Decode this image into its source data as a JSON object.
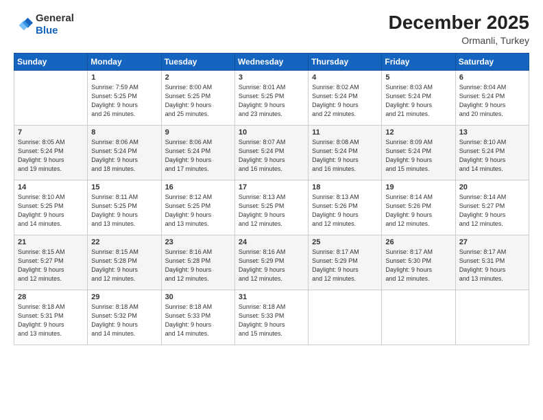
{
  "header": {
    "logo_line1": "General",
    "logo_line2": "Blue",
    "title": "December 2025",
    "subtitle": "Ormanli, Turkey"
  },
  "columns": [
    "Sunday",
    "Monday",
    "Tuesday",
    "Wednesday",
    "Thursday",
    "Friday",
    "Saturday"
  ],
  "weeks": [
    [
      {
        "day": "",
        "info": ""
      },
      {
        "day": "1",
        "info": "Sunrise: 7:59 AM\nSunset: 5:25 PM\nDaylight: 9 hours\nand 26 minutes."
      },
      {
        "day": "2",
        "info": "Sunrise: 8:00 AM\nSunset: 5:25 PM\nDaylight: 9 hours\nand 25 minutes."
      },
      {
        "day": "3",
        "info": "Sunrise: 8:01 AM\nSunset: 5:25 PM\nDaylight: 9 hours\nand 23 minutes."
      },
      {
        "day": "4",
        "info": "Sunrise: 8:02 AM\nSunset: 5:24 PM\nDaylight: 9 hours\nand 22 minutes."
      },
      {
        "day": "5",
        "info": "Sunrise: 8:03 AM\nSunset: 5:24 PM\nDaylight: 9 hours\nand 21 minutes."
      },
      {
        "day": "6",
        "info": "Sunrise: 8:04 AM\nSunset: 5:24 PM\nDaylight: 9 hours\nand 20 minutes."
      }
    ],
    [
      {
        "day": "7",
        "info": "Sunrise: 8:05 AM\nSunset: 5:24 PM\nDaylight: 9 hours\nand 19 minutes."
      },
      {
        "day": "8",
        "info": "Sunrise: 8:06 AM\nSunset: 5:24 PM\nDaylight: 9 hours\nand 18 minutes."
      },
      {
        "day": "9",
        "info": "Sunrise: 8:06 AM\nSunset: 5:24 PM\nDaylight: 9 hours\nand 17 minutes."
      },
      {
        "day": "10",
        "info": "Sunrise: 8:07 AM\nSunset: 5:24 PM\nDaylight: 9 hours\nand 16 minutes."
      },
      {
        "day": "11",
        "info": "Sunrise: 8:08 AM\nSunset: 5:24 PM\nDaylight: 9 hours\nand 16 minutes."
      },
      {
        "day": "12",
        "info": "Sunrise: 8:09 AM\nSunset: 5:24 PM\nDaylight: 9 hours\nand 15 minutes."
      },
      {
        "day": "13",
        "info": "Sunrise: 8:10 AM\nSunset: 5:24 PM\nDaylight: 9 hours\nand 14 minutes."
      }
    ],
    [
      {
        "day": "14",
        "info": "Sunrise: 8:10 AM\nSunset: 5:25 PM\nDaylight: 9 hours\nand 14 minutes."
      },
      {
        "day": "15",
        "info": "Sunrise: 8:11 AM\nSunset: 5:25 PM\nDaylight: 9 hours\nand 13 minutes."
      },
      {
        "day": "16",
        "info": "Sunrise: 8:12 AM\nSunset: 5:25 PM\nDaylight: 9 hours\nand 13 minutes."
      },
      {
        "day": "17",
        "info": "Sunrise: 8:13 AM\nSunset: 5:25 PM\nDaylight: 9 hours\nand 12 minutes."
      },
      {
        "day": "18",
        "info": "Sunrise: 8:13 AM\nSunset: 5:26 PM\nDaylight: 9 hours\nand 12 minutes."
      },
      {
        "day": "19",
        "info": "Sunrise: 8:14 AM\nSunset: 5:26 PM\nDaylight: 9 hours\nand 12 minutes."
      },
      {
        "day": "20",
        "info": "Sunrise: 8:14 AM\nSunset: 5:27 PM\nDaylight: 9 hours\nand 12 minutes."
      }
    ],
    [
      {
        "day": "21",
        "info": "Sunrise: 8:15 AM\nSunset: 5:27 PM\nDaylight: 9 hours\nand 12 minutes."
      },
      {
        "day": "22",
        "info": "Sunrise: 8:15 AM\nSunset: 5:28 PM\nDaylight: 9 hours\nand 12 minutes."
      },
      {
        "day": "23",
        "info": "Sunrise: 8:16 AM\nSunset: 5:28 PM\nDaylight: 9 hours\nand 12 minutes."
      },
      {
        "day": "24",
        "info": "Sunrise: 8:16 AM\nSunset: 5:29 PM\nDaylight: 9 hours\nand 12 minutes."
      },
      {
        "day": "25",
        "info": "Sunrise: 8:17 AM\nSunset: 5:29 PM\nDaylight: 9 hours\nand 12 minutes."
      },
      {
        "day": "26",
        "info": "Sunrise: 8:17 AM\nSunset: 5:30 PM\nDaylight: 9 hours\nand 12 minutes."
      },
      {
        "day": "27",
        "info": "Sunrise: 8:17 AM\nSunset: 5:31 PM\nDaylight: 9 hours\nand 13 minutes."
      }
    ],
    [
      {
        "day": "28",
        "info": "Sunrise: 8:18 AM\nSunset: 5:31 PM\nDaylight: 9 hours\nand 13 minutes."
      },
      {
        "day": "29",
        "info": "Sunrise: 8:18 AM\nSunset: 5:32 PM\nDaylight: 9 hours\nand 14 minutes."
      },
      {
        "day": "30",
        "info": "Sunrise: 8:18 AM\nSunset: 5:33 PM\nDaylight: 9 hours\nand 14 minutes."
      },
      {
        "day": "31",
        "info": "Sunrise: 8:18 AM\nSunset: 5:33 PM\nDaylight: 9 hours\nand 15 minutes."
      },
      {
        "day": "",
        "info": ""
      },
      {
        "day": "",
        "info": ""
      },
      {
        "day": "",
        "info": ""
      }
    ]
  ]
}
